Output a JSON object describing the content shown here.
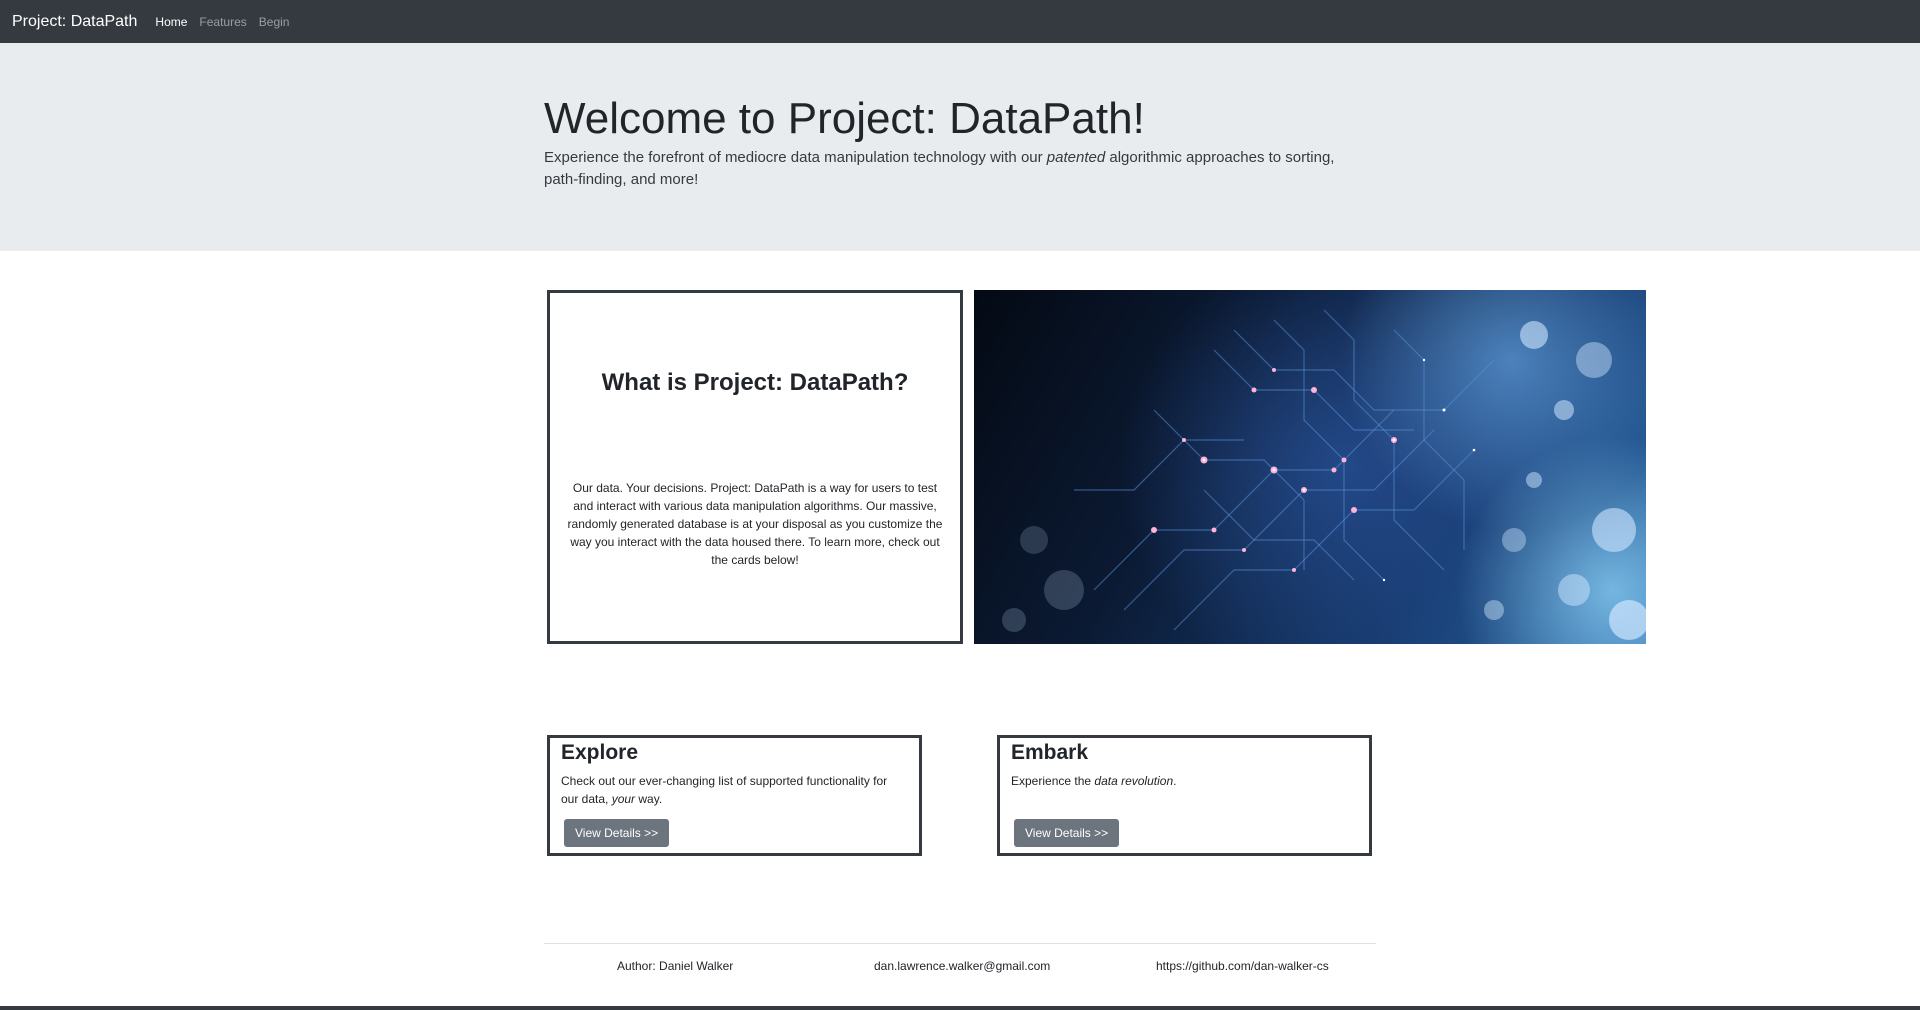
{
  "navbar": {
    "brand": "Project: DataPath",
    "links": [
      {
        "label": "Home",
        "active": true
      },
      {
        "label": "Features",
        "active": false
      },
      {
        "label": "Begin",
        "active": false
      }
    ]
  },
  "jumbotron": {
    "title": "Welcome to Project: DataPath!",
    "lead_before": "Experience the forefront of mediocre data manipulation technology with our ",
    "lead_em": "patented",
    "lead_after": " algorithmic approaches to sorting, path-finding, and more!"
  },
  "about": {
    "title": "What is Project: DataPath?",
    "text": "Our data. Your decisions. Project: DataPath is a way for users to test and interact with various data manipulation algorithms. Our massive, randomly generated database is at your disposal as you customize the way you interact with the data housed there. To learn more, check out the cards below!"
  },
  "hero_image": {
    "icon": "circuit-network-image"
  },
  "cards": [
    {
      "title": "Explore",
      "text_before": "Check out our ever-changing list of supported functionality for our data, ",
      "text_em": "your",
      "text_after": " way.",
      "button": "View Details >>"
    },
    {
      "title": "Embark",
      "text_before": "Experience the ",
      "text_em": "data revolution",
      "text_after": ".",
      "button": "View Details >>"
    }
  ],
  "footer": {
    "author": "Author: Daniel Walker",
    "email": "dan.lawrence.walker@gmail.com",
    "github": "https://github.com/dan-walker-cs"
  },
  "colors": {
    "navbar": "#343a40",
    "jumbotron": "#e9ecef",
    "button": "#6c757d"
  }
}
